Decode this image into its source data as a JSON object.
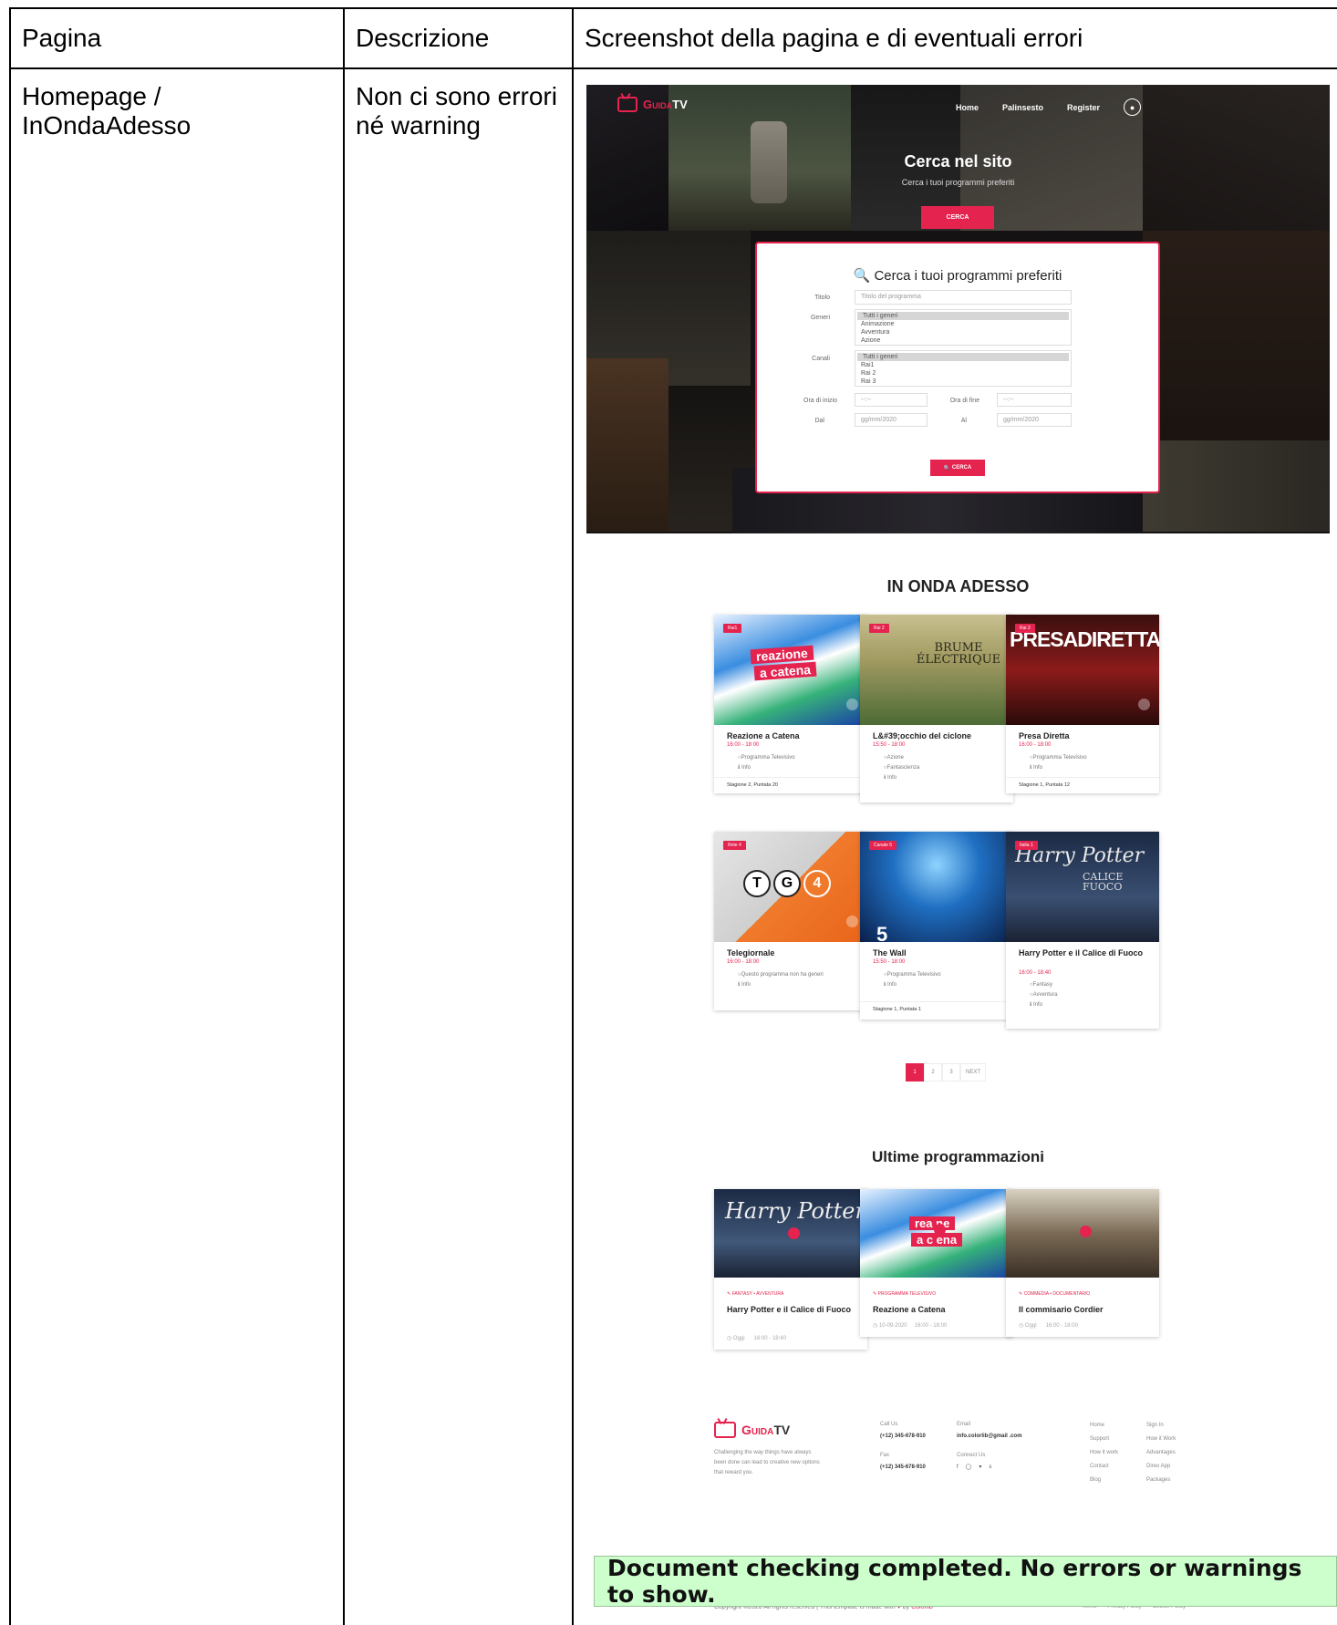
{
  "table": {
    "headers": [
      "Pagina",
      "Descrizione",
      "Screenshot della pagina e di eventuali errori"
    ],
    "row": {
      "page": "Homepage / InOndaAdesso",
      "description": "Non ci sono errori né warning"
    }
  },
  "site": {
    "logo_prefix": "Guida",
    "logo_suffix": "TV",
    "nav": [
      "Home",
      "Palinsesto",
      "Register"
    ],
    "hero_title": "Cerca nel sito",
    "hero_subtitle": "Cerca i tuoi programmi preferiti",
    "hero_button": "CERCA",
    "search": {
      "title": "Cerca i tuoi programmi preferiti",
      "title_label": "Titolo",
      "title_placeholder": "Titolo del programma",
      "genres_label": "Generi",
      "genres": [
        "Tutti i generi",
        "Animazione",
        "Avventura",
        "Azione"
      ],
      "channels_label": "Canali",
      "channels": [
        "Tutti i generi",
        "Rai1",
        "Rai 2",
        "Rai 3"
      ],
      "start_label": "Ora di inizio",
      "end_label": "Ora di fine",
      "time_placeholder": "--:--",
      "from_label": "Dal",
      "to_label": "Al",
      "date_placeholder": "gg/mm/2020",
      "button": "CERCA"
    },
    "on_air_title": "IN ONDA ADESSO",
    "cards": [
      {
        "channel": "Rai1",
        "title": "Reazione a Catena",
        "time": "16:00 - 18:00",
        "meta": [
          "Programma Televisivo",
          "Info"
        ],
        "foot": "Stagione 2, Puntata 20"
      },
      {
        "channel": "Rai 2",
        "title": "L&#39;occhio del ciclone",
        "time": "15:50 - 18:00",
        "meta": [
          "Azione",
          "Fantascienza",
          "Info"
        ],
        "foot": ""
      },
      {
        "channel": "Rai 3",
        "title": "Presa Diretta",
        "time": "16:00 - 18:00",
        "meta": [
          "Programma Televisivo",
          "Info"
        ],
        "foot": "Stagione 1, Puntata 12"
      },
      {
        "channel": "Rete 4",
        "title": "Telegiornale",
        "time": "16:00 - 18:00",
        "meta": [
          "Questo programma non ha generi",
          "Info"
        ],
        "foot": ""
      },
      {
        "channel": "Canale 5",
        "title": "The Wall",
        "time": "15:50 - 18:00",
        "meta": [
          "Programma Televisivo",
          "Info"
        ],
        "foot": "Stagione 1, Puntata 1"
      },
      {
        "channel": "Italia 1",
        "title": "Harry Potter e il Calice di Fuoco",
        "time": "16:00 - 18:40",
        "meta": [
          "Fantasy",
          "Avventura",
          "Info"
        ],
        "foot": ""
      }
    ],
    "pager": [
      "1",
      "2",
      "3",
      "NEXT"
    ],
    "latest_title": "Ultime programmazioni",
    "latest": [
      {
        "category": "FANTASY • AVVENTURA",
        "title": "Harry Potter e il Calice di Fuoco",
        "date": "Oggi",
        "time": "16:00 - 18:40"
      },
      {
        "category": "PROGRAMMA TELEVISIVO",
        "title": "Reazione a Catena",
        "date": "10-09-2020",
        "time": "16:00 - 18:00"
      },
      {
        "category": "COMMEDIA • DOCUMENTARIO",
        "title": "Il commisario Cordier",
        "date": "Oggi",
        "time": "16:00 - 18:00"
      }
    ],
    "footer": {
      "tagline": "Challenging the way things have always been done can lead to creative new options that reward you.",
      "call_label": "Call Us",
      "call_value": "(+12) 345-678-910",
      "fax_label": "Fax",
      "fax_value": "(+12) 345-678-910",
      "email_label": "Email",
      "email_value": "info.colorlib@gmail .com",
      "connect_label": "Connect Us",
      "links_a": [
        "Home",
        "Support",
        "How it work",
        "Contact",
        "Blog"
      ],
      "links_b": [
        "Sign In",
        "How it Work",
        "Advantages",
        "Direo App",
        "Packages"
      ],
      "copyright_pre": "Copyright ©2020 All rights reserved | This template is made with",
      "copyright_by": "by",
      "copyright_brand": "Colorlib",
      "legal": [
        "Terms",
        "Privacy Policy",
        "Cookie Policy"
      ]
    }
  },
  "validator_message": "Document checking completed. No errors or warnings to show.",
  "colors": {
    "accent": "#e5234f",
    "validator_bg": "#ccffcc"
  }
}
